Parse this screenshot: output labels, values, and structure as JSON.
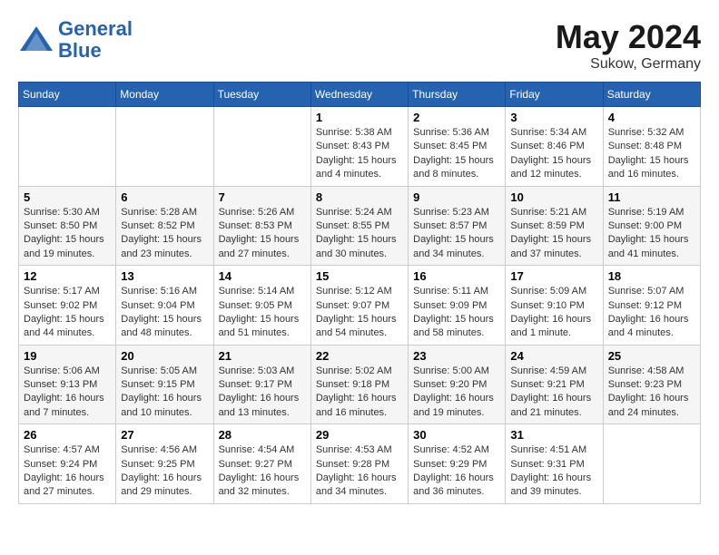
{
  "header": {
    "logo_line1": "General",
    "logo_line2": "Blue",
    "month": "May 2024",
    "location": "Sukow, Germany"
  },
  "weekdays": [
    "Sunday",
    "Monday",
    "Tuesday",
    "Wednesday",
    "Thursday",
    "Friday",
    "Saturday"
  ],
  "weeks": [
    [
      {
        "day": "",
        "info": ""
      },
      {
        "day": "",
        "info": ""
      },
      {
        "day": "",
        "info": ""
      },
      {
        "day": "1",
        "info": "Sunrise: 5:38 AM\nSunset: 8:43 PM\nDaylight: 15 hours\nand 4 minutes."
      },
      {
        "day": "2",
        "info": "Sunrise: 5:36 AM\nSunset: 8:45 PM\nDaylight: 15 hours\nand 8 minutes."
      },
      {
        "day": "3",
        "info": "Sunrise: 5:34 AM\nSunset: 8:46 PM\nDaylight: 15 hours\nand 12 minutes."
      },
      {
        "day": "4",
        "info": "Sunrise: 5:32 AM\nSunset: 8:48 PM\nDaylight: 15 hours\nand 16 minutes."
      }
    ],
    [
      {
        "day": "5",
        "info": "Sunrise: 5:30 AM\nSunset: 8:50 PM\nDaylight: 15 hours\nand 19 minutes."
      },
      {
        "day": "6",
        "info": "Sunrise: 5:28 AM\nSunset: 8:52 PM\nDaylight: 15 hours\nand 23 minutes."
      },
      {
        "day": "7",
        "info": "Sunrise: 5:26 AM\nSunset: 8:53 PM\nDaylight: 15 hours\nand 27 minutes."
      },
      {
        "day": "8",
        "info": "Sunrise: 5:24 AM\nSunset: 8:55 PM\nDaylight: 15 hours\nand 30 minutes."
      },
      {
        "day": "9",
        "info": "Sunrise: 5:23 AM\nSunset: 8:57 PM\nDaylight: 15 hours\nand 34 minutes."
      },
      {
        "day": "10",
        "info": "Sunrise: 5:21 AM\nSunset: 8:59 PM\nDaylight: 15 hours\nand 37 minutes."
      },
      {
        "day": "11",
        "info": "Sunrise: 5:19 AM\nSunset: 9:00 PM\nDaylight: 15 hours\nand 41 minutes."
      }
    ],
    [
      {
        "day": "12",
        "info": "Sunrise: 5:17 AM\nSunset: 9:02 PM\nDaylight: 15 hours\nand 44 minutes."
      },
      {
        "day": "13",
        "info": "Sunrise: 5:16 AM\nSunset: 9:04 PM\nDaylight: 15 hours\nand 48 minutes."
      },
      {
        "day": "14",
        "info": "Sunrise: 5:14 AM\nSunset: 9:05 PM\nDaylight: 15 hours\nand 51 minutes."
      },
      {
        "day": "15",
        "info": "Sunrise: 5:12 AM\nSunset: 9:07 PM\nDaylight: 15 hours\nand 54 minutes."
      },
      {
        "day": "16",
        "info": "Sunrise: 5:11 AM\nSunset: 9:09 PM\nDaylight: 15 hours\nand 58 minutes."
      },
      {
        "day": "17",
        "info": "Sunrise: 5:09 AM\nSunset: 9:10 PM\nDaylight: 16 hours\nand 1 minute."
      },
      {
        "day": "18",
        "info": "Sunrise: 5:07 AM\nSunset: 9:12 PM\nDaylight: 16 hours\nand 4 minutes."
      }
    ],
    [
      {
        "day": "19",
        "info": "Sunrise: 5:06 AM\nSunset: 9:13 PM\nDaylight: 16 hours\nand 7 minutes."
      },
      {
        "day": "20",
        "info": "Sunrise: 5:05 AM\nSunset: 9:15 PM\nDaylight: 16 hours\nand 10 minutes."
      },
      {
        "day": "21",
        "info": "Sunrise: 5:03 AM\nSunset: 9:17 PM\nDaylight: 16 hours\nand 13 minutes."
      },
      {
        "day": "22",
        "info": "Sunrise: 5:02 AM\nSunset: 9:18 PM\nDaylight: 16 hours\nand 16 minutes."
      },
      {
        "day": "23",
        "info": "Sunrise: 5:00 AM\nSunset: 9:20 PM\nDaylight: 16 hours\nand 19 minutes."
      },
      {
        "day": "24",
        "info": "Sunrise: 4:59 AM\nSunset: 9:21 PM\nDaylight: 16 hours\nand 21 minutes."
      },
      {
        "day": "25",
        "info": "Sunrise: 4:58 AM\nSunset: 9:23 PM\nDaylight: 16 hours\nand 24 minutes."
      }
    ],
    [
      {
        "day": "26",
        "info": "Sunrise: 4:57 AM\nSunset: 9:24 PM\nDaylight: 16 hours\nand 27 minutes."
      },
      {
        "day": "27",
        "info": "Sunrise: 4:56 AM\nSunset: 9:25 PM\nDaylight: 16 hours\nand 29 minutes."
      },
      {
        "day": "28",
        "info": "Sunrise: 4:54 AM\nSunset: 9:27 PM\nDaylight: 16 hours\nand 32 minutes."
      },
      {
        "day": "29",
        "info": "Sunrise: 4:53 AM\nSunset: 9:28 PM\nDaylight: 16 hours\nand 34 minutes."
      },
      {
        "day": "30",
        "info": "Sunrise: 4:52 AM\nSunset: 9:29 PM\nDaylight: 16 hours\nand 36 minutes."
      },
      {
        "day": "31",
        "info": "Sunrise: 4:51 AM\nSunset: 9:31 PM\nDaylight: 16 hours\nand 39 minutes."
      },
      {
        "day": "",
        "info": ""
      }
    ]
  ]
}
